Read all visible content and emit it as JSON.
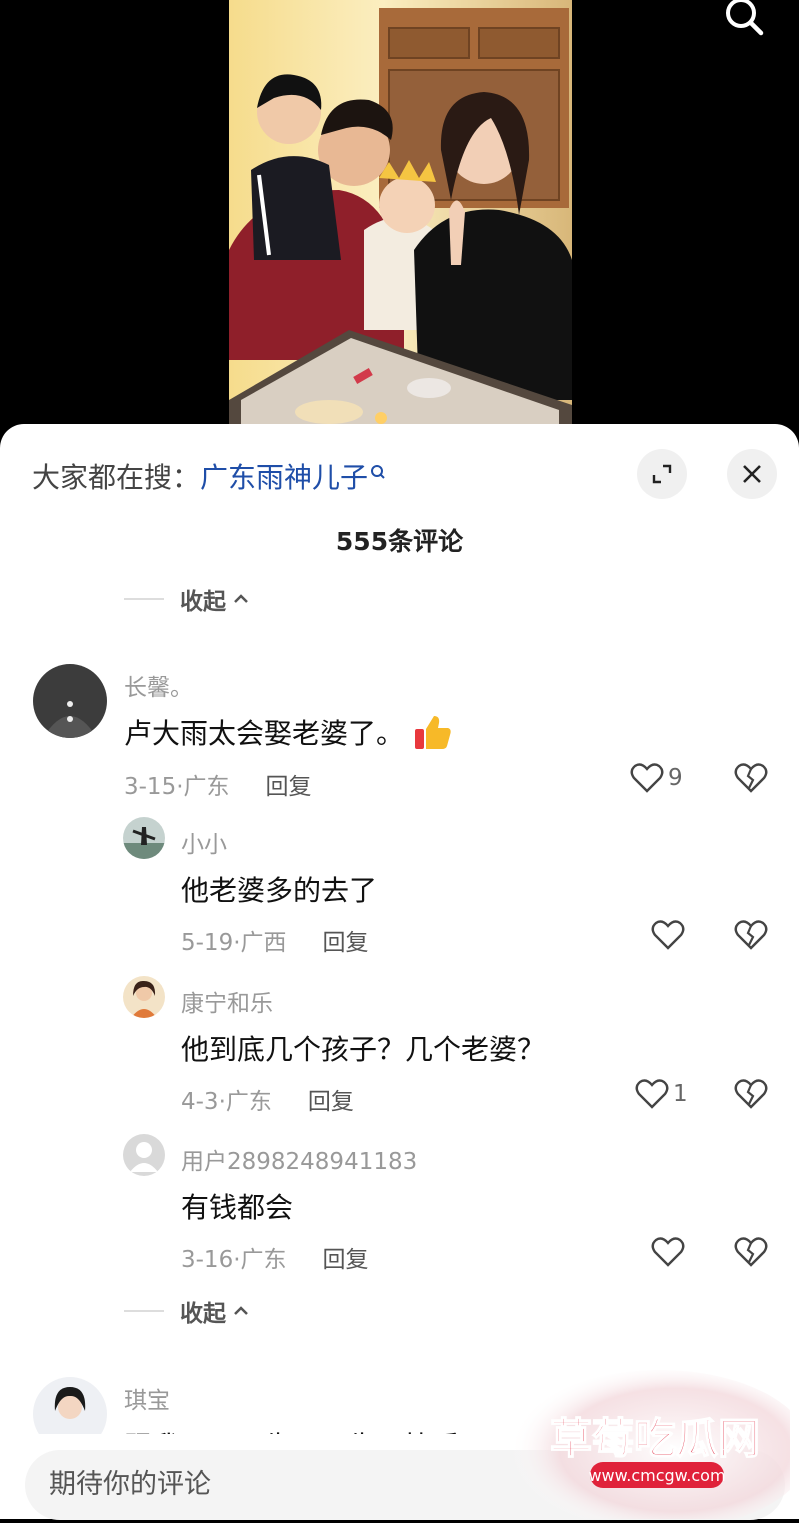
{
  "hot_search": {
    "prefix": "大家都在搜：",
    "term": "广东雨神儿子"
  },
  "comment_count": "555条评论",
  "collapse_label": "收起",
  "reply_label": "回复",
  "comments": [
    {
      "user": "长馨。",
      "text": "卢大雨太会娶老婆了。",
      "emoji": "thumbs-up-icon",
      "date": "3-15",
      "location": "广东",
      "likes": "9"
    },
    {
      "user": "小小",
      "text": "他老婆多的去了",
      "date": "5-19",
      "location": "广西",
      "likes": ""
    },
    {
      "user": "康宁和乐",
      "text": "他到底几个孩子？几个老婆？",
      "date": "4-3",
      "location": "广东",
      "likes": "1"
    },
    {
      "user": "用户2898248941183",
      "text": "有钱都会",
      "date": "3-16",
      "location": "广东",
      "likes": ""
    },
    {
      "user": "琪宝",
      "text": "跟我同一天生日，生日快乐"
    }
  ],
  "input": {
    "placeholder": "期待你的评论"
  },
  "watermark": {
    "title": "草莓吃瓜网",
    "url": "www.cmcgw.com"
  },
  "colors": {
    "link": "#1f4ea8",
    "meta": "#999999",
    "watermark": "#e0223a"
  }
}
